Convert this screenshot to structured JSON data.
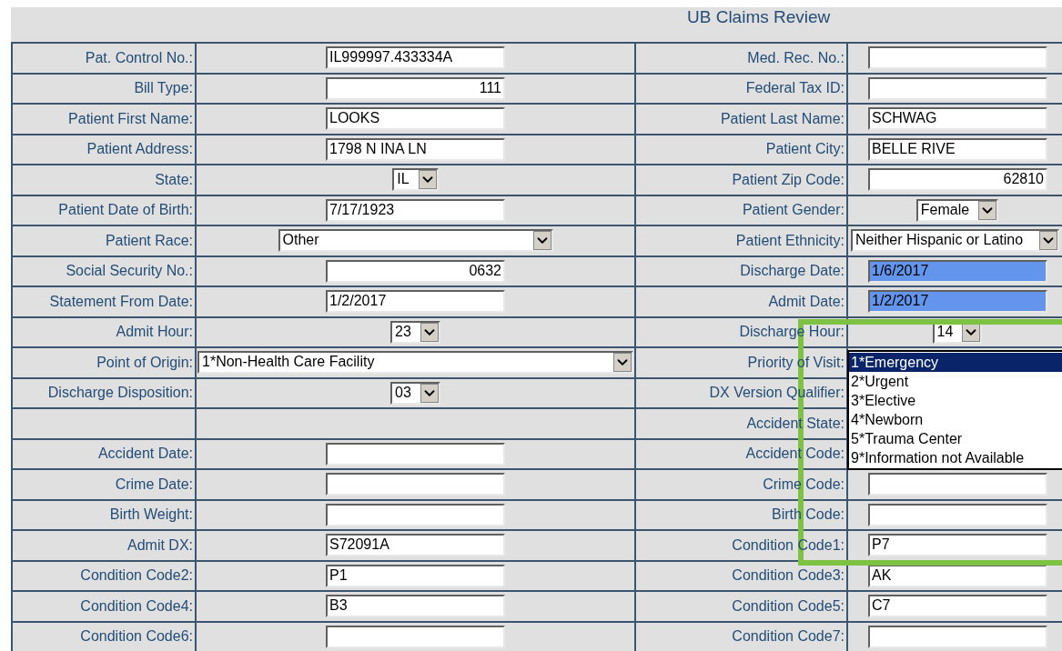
{
  "title": "UB Claims Review",
  "rows": [
    {
      "left": {
        "label": "Pat. Control No.:",
        "field": {
          "kind": "input",
          "value": "IL999997.433334A",
          "right_aligned": false,
          "highlighted": false
        }
      },
      "right": {
        "label": "Med. Rec. No.:",
        "field": {
          "kind": "input",
          "highlighted": false
        }
      }
    },
    {
      "left": {
        "label": "Bill Type:",
        "field": {
          "kind": "input",
          "value": "111",
          "right_aligned": true,
          "highlighted": false
        }
      },
      "right": {
        "label": "Federal Tax ID:",
        "field": {
          "kind": "input",
          "highlighted": false
        }
      }
    },
    {
      "left": {
        "label": "Patient First Name:",
        "field": {
          "kind": "input",
          "value": "LOOKS",
          "right_aligned": false,
          "highlighted": false
        }
      },
      "right": {
        "label": "Patient Last Name:",
        "field": {
          "kind": "input",
          "value": "SCHWAG",
          "right_aligned": false,
          "highlighted": false
        }
      }
    },
    {
      "left": {
        "label": "Patient Address:",
        "field": {
          "kind": "input",
          "value": "1798 N INA LN",
          "right_aligned": false,
          "highlighted": false
        }
      },
      "right": {
        "label": "Patient City:",
        "field": {
          "kind": "input",
          "value": "BELLE RIVE",
          "right_aligned": false,
          "highlighted": false
        }
      }
    },
    {
      "left": {
        "label": "State:",
        "field": {
          "kind": "dropdown",
          "value": "IL"
        }
      },
      "right": {
        "label": "Patient Zip Code:",
        "field": {
          "kind": "input",
          "value": "62810",
          "right_aligned": true,
          "highlighted": false
        }
      }
    },
    {
      "left": {
        "label": "Patient Date of Birth:",
        "field": {
          "kind": "input",
          "value": "7/17/1923",
          "right_aligned": false,
          "highlighted": false
        }
      },
      "right": {
        "label": "Patient Gender:",
        "field": {
          "kind": "dropdown",
          "value": "Female"
        }
      }
    },
    {
      "left": {
        "label": "Patient Race:",
        "field": {
          "kind": "wide-dropdown",
          "value": "Other"
        }
      },
      "right": {
        "label": "Patient Ethnicity:",
        "field": {
          "kind": "full-dropdown",
          "value": "Neither Hispanic or Latino"
        }
      }
    },
    {
      "left": {
        "label": "Social Security No.:",
        "field": {
          "kind": "input",
          "value": "0632",
          "right_aligned": true,
          "highlighted": false
        }
      },
      "right": {
        "label": "Discharge Date:",
        "field": {
          "kind": "input",
          "value": "1/6/2017",
          "right_aligned": false,
          "highlighted": true
        }
      }
    },
    {
      "left": {
        "label": "Statement From Date:",
        "field": {
          "kind": "input",
          "value": "1/2/2017",
          "right_aligned": false,
          "highlighted": false
        }
      },
      "right": {
        "label": "Admit Date:",
        "field": {
          "kind": "input",
          "value": "1/2/2017",
          "right_aligned": false,
          "highlighted": true
        }
      }
    },
    {
      "left": {
        "label": "Admit Hour:",
        "field": {
          "kind": "dropdown",
          "value": "23"
        }
      },
      "right": {
        "label": "Discharge Hour:",
        "field": {
          "kind": "dropdown",
          "value": "14"
        }
      }
    },
    {
      "left": {
        "label": "Point of Origin:",
        "field": {
          "kind": "full-dropdown",
          "value": "1*Non-Health Care Facility"
        }
      },
      "right": {
        "label": "Priority of Visit:"
      }
    },
    {
      "left": {
        "label": "Discharge Disposition:",
        "field": {
          "kind": "dropdown",
          "value": "03"
        }
      },
      "right": {
        "label": "DX Version Qualifier:"
      }
    },
    {
      "left": {},
      "right": {
        "label": "Accident State:"
      }
    },
    {
      "left": {
        "label": "Accident Date:",
        "field": {
          "kind": "input",
          "highlighted": false
        }
      },
      "right": {
        "label": "Accident Code:"
      }
    },
    {
      "left": {
        "label": "Crime Date:",
        "field": {
          "kind": "input",
          "highlighted": false
        }
      },
      "right": {
        "label": "Crime Code:",
        "field": {
          "kind": "input",
          "highlighted": false
        }
      }
    },
    {
      "left": {
        "label": "Birth Weight:",
        "field": {
          "kind": "input",
          "highlighted": false
        }
      },
      "right": {
        "label": "Birth Code:",
        "field": {
          "kind": "input",
          "highlighted": false
        }
      }
    },
    {
      "left": {
        "label": "Admit DX:",
        "field": {
          "kind": "input",
          "value": "S72091A",
          "right_aligned": false,
          "highlighted": false
        }
      },
      "right": {
        "label": "Condition Code1:",
        "field": {
          "kind": "input",
          "value": "P7",
          "right_aligned": false,
          "highlighted": false
        }
      }
    },
    {
      "left": {
        "label": "Condition Code2:",
        "field": {
          "kind": "input",
          "value": "P1",
          "right_aligned": false,
          "highlighted": false
        }
      },
      "right": {
        "label": "Condition Code3:",
        "field": {
          "kind": "input",
          "value": "AK",
          "right_aligned": false,
          "highlighted": false
        }
      }
    },
    {
      "left": {
        "label": "Condition Code4:",
        "field": {
          "kind": "input",
          "value": "B3",
          "right_aligned": false,
          "highlighted": false
        }
      },
      "right": {
        "label": "Condition Code5:",
        "field": {
          "kind": "input",
          "value": "C7",
          "right_aligned": false,
          "highlighted": false
        }
      }
    },
    {
      "left": {
        "label": "Condition Code6:",
        "field": {
          "kind": "input",
          "highlighted": false
        }
      },
      "right": {
        "label": "Condition Code7:",
        "field": {
          "kind": "input",
          "highlighted": false
        }
      }
    }
  ],
  "open_list": {
    "options": [
      {
        "label": "1*Emergency",
        "selected": true
      },
      {
        "label": "2*Urgent",
        "selected": false
      },
      {
        "label": "3*Elective",
        "selected": false
      },
      {
        "label": "4*Newborn",
        "selected": false
      },
      {
        "label": "5*Trauma Center",
        "selected": false
      },
      {
        "label": "9*Information not Available",
        "selected": false
      }
    ]
  }
}
